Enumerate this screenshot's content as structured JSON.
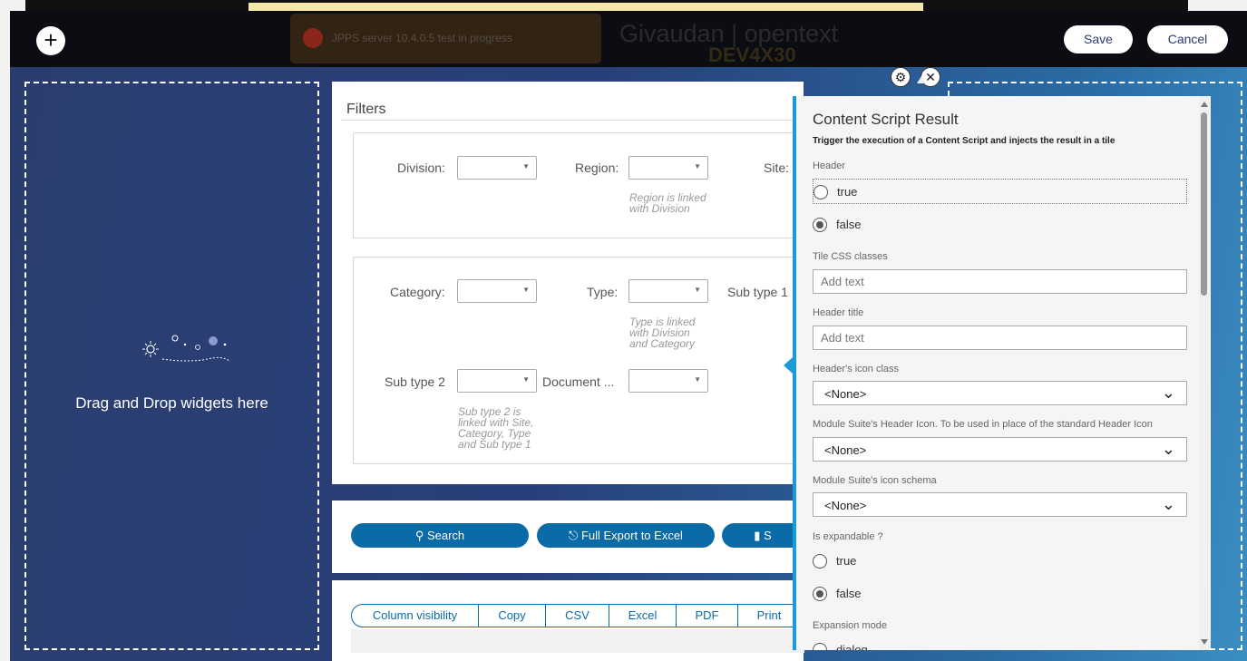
{
  "toolbar": {
    "save_label": "Save",
    "cancel_label": "Cancel",
    "add_icon": "plus-icon"
  },
  "background": {
    "alert_text": "JPPS server 10.4.0.5 test in progress",
    "brand_text": "Givaudan | opentext",
    "env_text": "DEV4X30"
  },
  "drop_zone": {
    "text": "Drag and Drop widgets here",
    "icon": "sparkle-stars-icon"
  },
  "filters": {
    "title": "Filters",
    "division_label": "Division:",
    "region_label": "Region:",
    "region_hint_1": "Region is linked",
    "region_hint_2": "with Division",
    "site_label": "Site:",
    "category_label": "Category:",
    "type_label": "Type:",
    "type_hint_1": "Type is linked",
    "type_hint_2": "with Division",
    "type_hint_3": "and Category",
    "subtype1_label": "Sub type 1",
    "subtype2_label": "Sub type 2",
    "document_label": "Document ...",
    "subtype2_hint_1": "Sub type 2 is",
    "subtype2_hint_2": "linked with Site,",
    "subtype2_hint_3": "Category, Type",
    "subtype2_hint_4": "and Sub type 1"
  },
  "actions": {
    "search_label": "Search",
    "export_label": "Full Export to Excel",
    "stats_label": "S"
  },
  "table_buttons": [
    "Column visibility",
    "Copy",
    "CSV",
    "Excel",
    "PDF",
    "Print"
  ],
  "flyout": {
    "title": "Content Script Result",
    "subtitle": "Trigger the execution of a Content Script and injects the result in a tile",
    "header_label": "Header",
    "header_true": "true",
    "header_false": "false",
    "header_value": "false",
    "css_label": "Tile CSS classes",
    "css_placeholder": "Add text",
    "header_title_label": "Header title",
    "header_title_placeholder": "Add text",
    "icon_class_label": "Header's icon class",
    "icon_class_value": "<None>",
    "ms_icon_label": "Module Suite's Header Icon. To be used in place of the standard Header Icon",
    "ms_icon_value": "<None>",
    "ms_schema_label": "Module Suite's icon schema",
    "ms_schema_value": "<None>",
    "expandable_label": "Is expandable ?",
    "expandable_true": "true",
    "expandable_false": "false",
    "expandable_value": "false",
    "expansion_label": "Expansion mode",
    "expansion_first": "dialog"
  },
  "colors": {
    "accent": "#1a9bd7",
    "button": "#0b6aa8",
    "topbar": "#0b0d12"
  }
}
